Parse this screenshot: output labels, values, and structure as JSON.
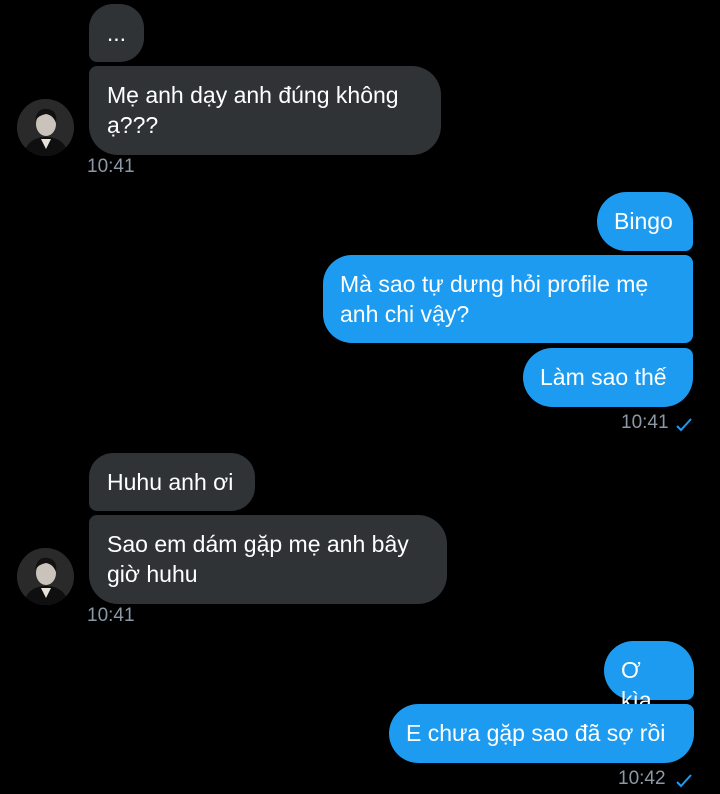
{
  "conversation": {
    "group1": {
      "messages": [
        "...",
        "Mẹ anh dạy anh đúng không ạ???"
      ],
      "time": "10:41"
    },
    "group2": {
      "messages": [
        "Bingo",
        "Mà sao tự dưng hỏi profile mẹ anh chi vậy?",
        "Làm sao thế"
      ],
      "time": "10:41"
    },
    "group3": {
      "messages": [
        "Huhu anh ơi",
        "Sao em dám gặp mẹ anh bây giờ huhu"
      ],
      "time": "10:41"
    },
    "group4": {
      "messages": [
        "Ơ kìa",
        "E chưa gặp sao đã sợ rồi"
      ],
      "time": "10:42"
    }
  },
  "icons": {
    "avatar": "contact-avatar-icon",
    "read_receipt": "checkmark-icon"
  },
  "colors": {
    "background": "#000000",
    "incoming_bubble": "#2f3336",
    "outgoing_bubble": "#1d9bf0",
    "timestamp": "#8b98a5"
  }
}
